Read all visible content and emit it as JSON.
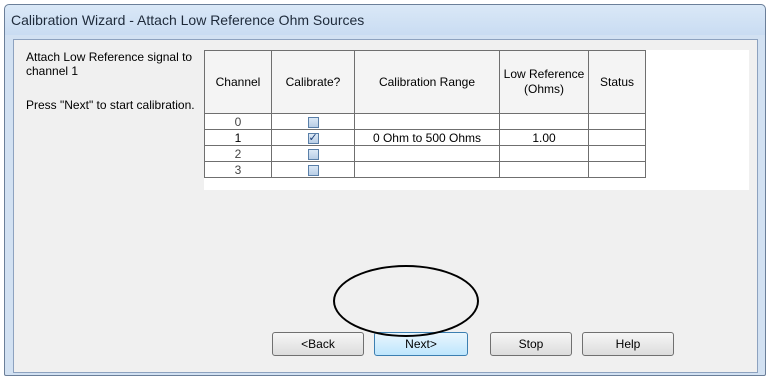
{
  "window": {
    "title": "Calibration Wizard - Attach Low Reference Ohm Sources"
  },
  "instructions": {
    "line1": "Attach Low Reference signal to channel 1",
    "line2": "Press \"Next\" to start calibration."
  },
  "table": {
    "headers": {
      "channel": "Channel",
      "calibrate": "Calibrate?",
      "range": "Calibration Range",
      "low_reference": "Low Reference (Ohms)",
      "status": "Status"
    },
    "rows": [
      {
        "channel": "0",
        "calibrate": false,
        "range": "",
        "low_reference": "",
        "status": ""
      },
      {
        "channel": "1",
        "calibrate": true,
        "range": "0 Ohm to 500 Ohms",
        "low_reference": "1.00",
        "status": ""
      },
      {
        "channel": "2",
        "calibrate": false,
        "range": "",
        "low_reference": "",
        "status": ""
      },
      {
        "channel": "3",
        "calibrate": false,
        "range": "",
        "low_reference": "",
        "status": ""
      }
    ]
  },
  "buttons": {
    "back": "<Back",
    "next": "Next>",
    "stop": "Stop",
    "help": "Help"
  },
  "colors": {
    "title_bar": "#c9dcf2",
    "accent_default_button": "#3c7fb1"
  }
}
